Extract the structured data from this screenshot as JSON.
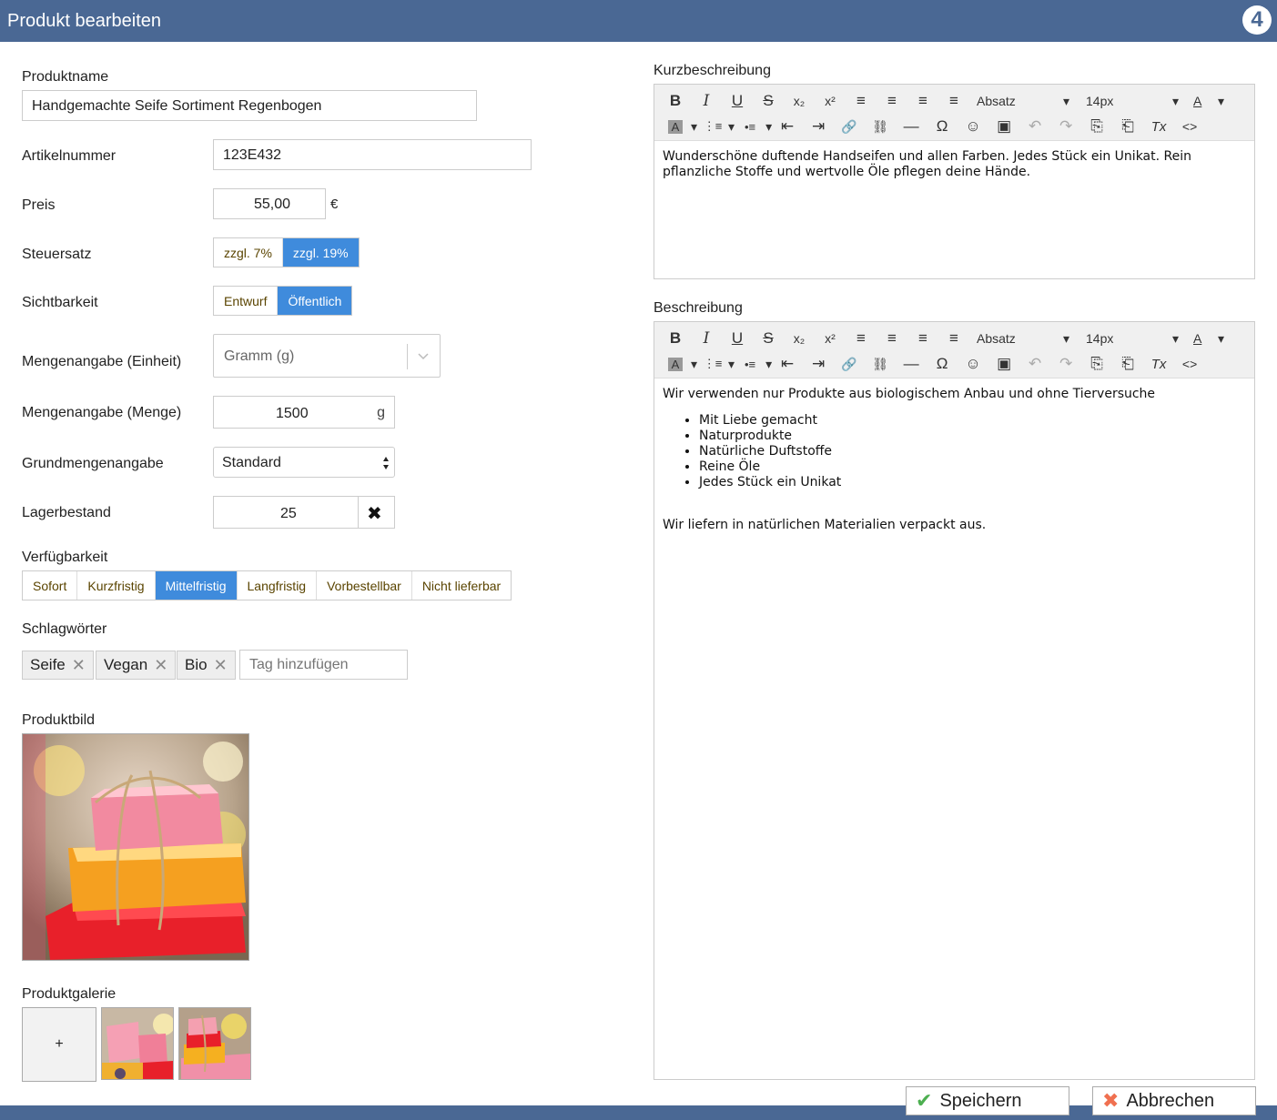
{
  "window": {
    "title": "Produkt bearbeiten",
    "logo_text": "4"
  },
  "form": {
    "name": {
      "label": "Produktname",
      "value": "Handgemachte Seife Sortiment Regenbogen"
    },
    "sku": {
      "label": "Artikelnummer",
      "value": "123E432"
    },
    "price": {
      "label": "Preis",
      "value": "55,00",
      "currency": "€"
    },
    "tax": {
      "label": "Steuersatz",
      "options": [
        "zzgl. 7%",
        "zzgl. 19%"
      ],
      "selected": "zzgl. 19%"
    },
    "visibility": {
      "label": "Sichtbarkeit",
      "options": [
        "Entwurf",
        "Öffentlich"
      ],
      "selected": "Öffentlich"
    },
    "unit": {
      "label": "Mengenangabe (Einheit)",
      "value": "Gramm (g)"
    },
    "quantity": {
      "label": "Mengenangabe (Menge)",
      "value": "1500",
      "unit": "g"
    },
    "base_unit": {
      "label": "Grundmengenangabe",
      "value": "Standard"
    },
    "stock": {
      "label": "Lagerbestand",
      "value": "25",
      "clear": "✖"
    },
    "availability": {
      "label": "Verfügbarkeit",
      "options": [
        "Sofort",
        "Kurzfristig",
        "Mittelfristig",
        "Langfristig",
        "Vorbestellbar",
        "Nicht lieferbar"
      ],
      "selected": "Mittelfristig"
    },
    "tags": {
      "label": "Schlagwörter",
      "items": [
        "Seife",
        "Vegan",
        "Bio"
      ],
      "placeholder": "Tag hinzufügen",
      "remove": "✕"
    },
    "image": {
      "label": "Produktbild"
    },
    "gallery": {
      "label": "Produktgalerie",
      "add": "+"
    }
  },
  "editor_toolbar": {
    "row1": [
      "B",
      "I",
      "U",
      "S",
      "x₂",
      "x²",
      "≡",
      "≡",
      "≡",
      "≡"
    ],
    "format": "Absatz",
    "size": "14px",
    "color": "A",
    "caret": "▾",
    "row2": [
      "A",
      "⋮≡",
      "•≡",
      "⇤",
      "⇥",
      "🔗",
      "⛓",
      "—",
      "Ω",
      "☺",
      "▣",
      "↶",
      "↷",
      "⎘",
      "⎗",
      "Tx",
      "<>"
    ]
  },
  "short_desc": {
    "label": "Kurzbeschreibung",
    "text": "Wunderschöne duftende Handseifen und allen Farben. Jedes Stück ein Unikat. Rein pflanzliche Stoffe und wertvolle Öle pflegen deine Hände."
  },
  "description": {
    "label": "Beschreibung",
    "intro": "Wir verwenden nur Produkte aus biologischem Anbau und ohne Tierversuche",
    "bullets": [
      "Mit Liebe gemacht",
      "Naturprodukte",
      "Natürliche Duftstoffe",
      "Reine Öle",
      "Jedes Stück ein Unikat"
    ],
    "outro": "Wir liefern in natürlichen Materialien verpackt aus."
  },
  "actions": {
    "save": "Speichern",
    "save_icon": "✔",
    "cancel": "Abbrechen",
    "cancel_icon": "✖"
  },
  "colors": {
    "header": "#4a6894",
    "accent": "#3f8bdc",
    "save": "#4caf50",
    "cancel": "#f07050"
  }
}
